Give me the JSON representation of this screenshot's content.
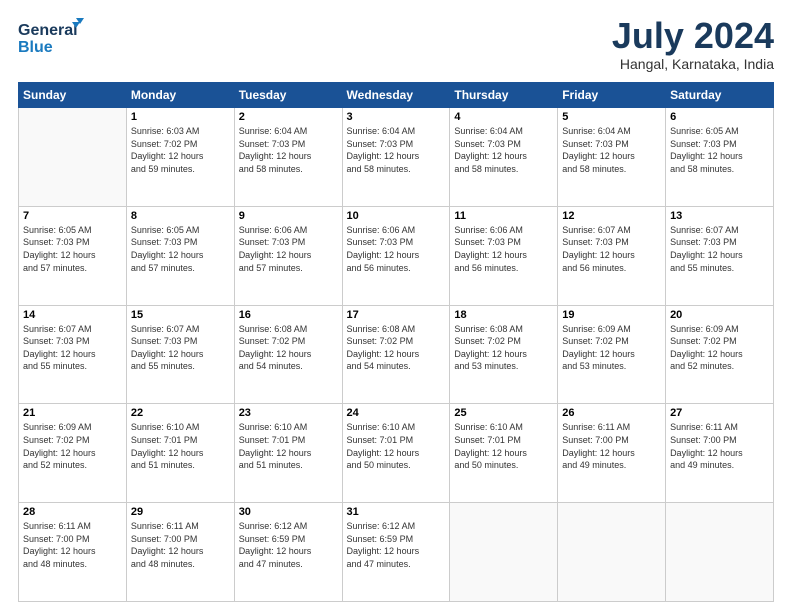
{
  "header": {
    "logo_line1": "General",
    "logo_line2": "Blue",
    "title": "July 2024",
    "location": "Hangal, Karnataka, India"
  },
  "columns": [
    "Sunday",
    "Monday",
    "Tuesday",
    "Wednesday",
    "Thursday",
    "Friday",
    "Saturday"
  ],
  "weeks": [
    [
      {
        "day": "",
        "info": ""
      },
      {
        "day": "1",
        "info": "Sunrise: 6:03 AM\nSunset: 7:02 PM\nDaylight: 12 hours\nand 59 minutes."
      },
      {
        "day": "2",
        "info": "Sunrise: 6:04 AM\nSunset: 7:03 PM\nDaylight: 12 hours\nand 58 minutes."
      },
      {
        "day": "3",
        "info": "Sunrise: 6:04 AM\nSunset: 7:03 PM\nDaylight: 12 hours\nand 58 minutes."
      },
      {
        "day": "4",
        "info": "Sunrise: 6:04 AM\nSunset: 7:03 PM\nDaylight: 12 hours\nand 58 minutes."
      },
      {
        "day": "5",
        "info": "Sunrise: 6:04 AM\nSunset: 7:03 PM\nDaylight: 12 hours\nand 58 minutes."
      },
      {
        "day": "6",
        "info": "Sunrise: 6:05 AM\nSunset: 7:03 PM\nDaylight: 12 hours\nand 58 minutes."
      }
    ],
    [
      {
        "day": "7",
        "info": "Sunrise: 6:05 AM\nSunset: 7:03 PM\nDaylight: 12 hours\nand 57 minutes."
      },
      {
        "day": "8",
        "info": "Sunrise: 6:05 AM\nSunset: 7:03 PM\nDaylight: 12 hours\nand 57 minutes."
      },
      {
        "day": "9",
        "info": "Sunrise: 6:06 AM\nSunset: 7:03 PM\nDaylight: 12 hours\nand 57 minutes."
      },
      {
        "day": "10",
        "info": "Sunrise: 6:06 AM\nSunset: 7:03 PM\nDaylight: 12 hours\nand 56 minutes."
      },
      {
        "day": "11",
        "info": "Sunrise: 6:06 AM\nSunset: 7:03 PM\nDaylight: 12 hours\nand 56 minutes."
      },
      {
        "day": "12",
        "info": "Sunrise: 6:07 AM\nSunset: 7:03 PM\nDaylight: 12 hours\nand 56 minutes."
      },
      {
        "day": "13",
        "info": "Sunrise: 6:07 AM\nSunset: 7:03 PM\nDaylight: 12 hours\nand 55 minutes."
      }
    ],
    [
      {
        "day": "14",
        "info": "Sunrise: 6:07 AM\nSunset: 7:03 PM\nDaylight: 12 hours\nand 55 minutes."
      },
      {
        "day": "15",
        "info": "Sunrise: 6:07 AM\nSunset: 7:03 PM\nDaylight: 12 hours\nand 55 minutes."
      },
      {
        "day": "16",
        "info": "Sunrise: 6:08 AM\nSunset: 7:02 PM\nDaylight: 12 hours\nand 54 minutes."
      },
      {
        "day": "17",
        "info": "Sunrise: 6:08 AM\nSunset: 7:02 PM\nDaylight: 12 hours\nand 54 minutes."
      },
      {
        "day": "18",
        "info": "Sunrise: 6:08 AM\nSunset: 7:02 PM\nDaylight: 12 hours\nand 53 minutes."
      },
      {
        "day": "19",
        "info": "Sunrise: 6:09 AM\nSunset: 7:02 PM\nDaylight: 12 hours\nand 53 minutes."
      },
      {
        "day": "20",
        "info": "Sunrise: 6:09 AM\nSunset: 7:02 PM\nDaylight: 12 hours\nand 52 minutes."
      }
    ],
    [
      {
        "day": "21",
        "info": "Sunrise: 6:09 AM\nSunset: 7:02 PM\nDaylight: 12 hours\nand 52 minutes."
      },
      {
        "day": "22",
        "info": "Sunrise: 6:10 AM\nSunset: 7:01 PM\nDaylight: 12 hours\nand 51 minutes."
      },
      {
        "day": "23",
        "info": "Sunrise: 6:10 AM\nSunset: 7:01 PM\nDaylight: 12 hours\nand 51 minutes."
      },
      {
        "day": "24",
        "info": "Sunrise: 6:10 AM\nSunset: 7:01 PM\nDaylight: 12 hours\nand 50 minutes."
      },
      {
        "day": "25",
        "info": "Sunrise: 6:10 AM\nSunset: 7:01 PM\nDaylight: 12 hours\nand 50 minutes."
      },
      {
        "day": "26",
        "info": "Sunrise: 6:11 AM\nSunset: 7:00 PM\nDaylight: 12 hours\nand 49 minutes."
      },
      {
        "day": "27",
        "info": "Sunrise: 6:11 AM\nSunset: 7:00 PM\nDaylight: 12 hours\nand 49 minutes."
      }
    ],
    [
      {
        "day": "28",
        "info": "Sunrise: 6:11 AM\nSunset: 7:00 PM\nDaylight: 12 hours\nand 48 minutes."
      },
      {
        "day": "29",
        "info": "Sunrise: 6:11 AM\nSunset: 7:00 PM\nDaylight: 12 hours\nand 48 minutes."
      },
      {
        "day": "30",
        "info": "Sunrise: 6:12 AM\nSunset: 6:59 PM\nDaylight: 12 hours\nand 47 minutes."
      },
      {
        "day": "31",
        "info": "Sunrise: 6:12 AM\nSunset: 6:59 PM\nDaylight: 12 hours\nand 47 minutes."
      },
      {
        "day": "",
        "info": ""
      },
      {
        "day": "",
        "info": ""
      },
      {
        "day": "",
        "info": ""
      }
    ]
  ]
}
